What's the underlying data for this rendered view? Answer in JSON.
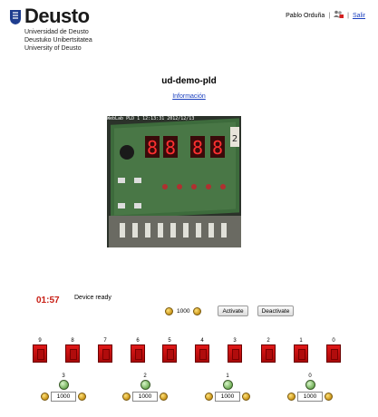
{
  "header": {
    "logo_text": "Deusto",
    "university_lines": [
      "Universidad de Deusto",
      "Deustuko Unibertsitatea",
      "University of Deusto"
    ],
    "user_name": "Pablo Orduña",
    "separator": "|",
    "logout_label": "Salir",
    "logout_icon": "users-logout-icon"
  },
  "experiment": {
    "title": "ud-demo-pld",
    "info_link": "Información"
  },
  "webcam": {
    "overlay_text": "WebLab PLD 1 12:13:31 2012/12/13",
    "display_digits": [
      "8",
      "8",
      "8",
      "8"
    ],
    "sticker": "2"
  },
  "status": {
    "timer": "01:57",
    "message": "Device ready"
  },
  "controls": {
    "clock_value": "1000",
    "activate_label": "Activate",
    "deactivate_label": "Deactivate"
  },
  "switches": [
    {
      "label": "9"
    },
    {
      "label": "8"
    },
    {
      "label": "7"
    },
    {
      "label": "6"
    },
    {
      "label": "5"
    },
    {
      "label": "4"
    },
    {
      "label": "3"
    },
    {
      "label": "2"
    },
    {
      "label": "1"
    },
    {
      "label": "0"
    }
  ],
  "leds": [
    {
      "label": "3",
      "value": "1000"
    },
    {
      "label": "2",
      "value": "1000"
    },
    {
      "label": "1",
      "value": "1000"
    },
    {
      "label": "0",
      "value": "1000"
    }
  ],
  "colors": {
    "timer": "#c81e14",
    "switch": "#d01010",
    "link": "#1a3fbf",
    "led": "#6fae56"
  }
}
